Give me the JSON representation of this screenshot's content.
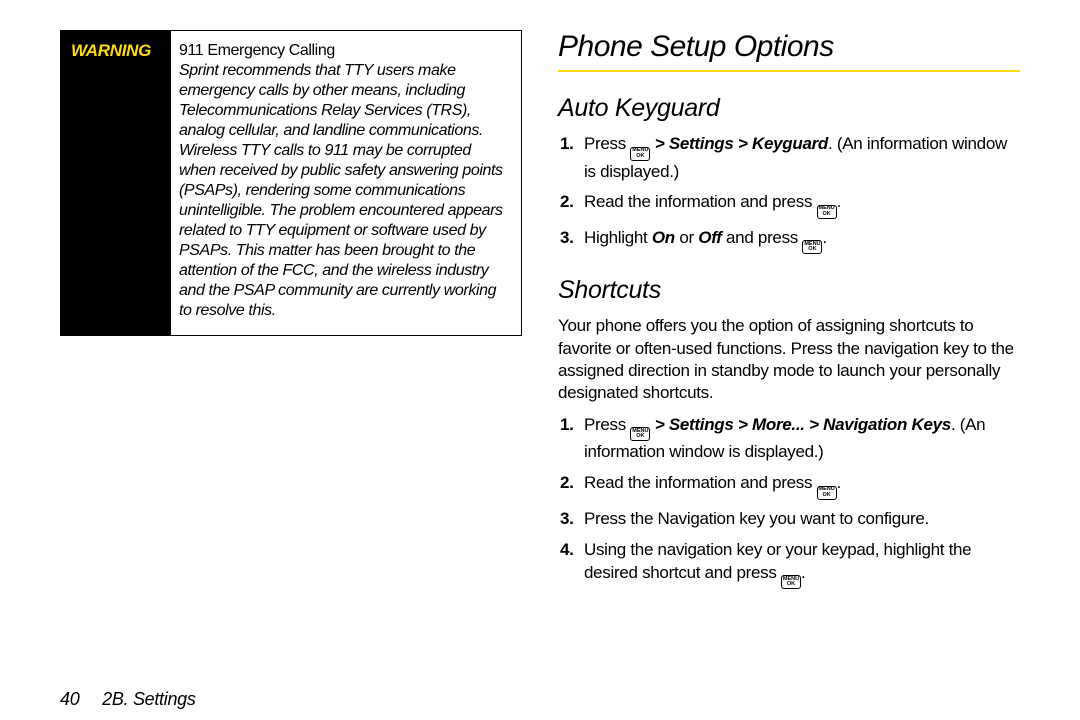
{
  "warning": {
    "label": "WARNING",
    "title": "911 Emergency Calling",
    "body": "Sprint recommends that TTY users make emergency calls by other means, including Telecommunications Relay Services (TRS), analog cellular, and landline communications. Wireless TTY calls to 911 may be corrupted when received by public safety answering points (PSAPs), rendering some communications unintelligible. The problem encountered appears related to TTY equipment or software used by PSAPs. This matter has been brought to the attention of the FCC, and the wireless industry and the PSAP community are currently working to resolve this."
  },
  "right": {
    "h1": "Phone Setup Options",
    "autokeyguard": {
      "h2": "Auto Keyguard",
      "steps": {
        "s1a": "Press ",
        "s1b": " > Settings > Keyguard",
        "s1c": ". (An information window is displayed.)",
        "s2a": "Read the information and press ",
        "s2b": ".",
        "s3a": "Highlight ",
        "s3b": "On",
        "s3c": " or ",
        "s3d": "Off",
        "s3e": " and press ",
        "s3f": "."
      }
    },
    "shortcuts": {
      "h2": "Shortcuts",
      "para": "Your phone offers you the option of assigning shortcuts to favorite or often-used functions. Press the navigation key to the assigned direction in standby mode to launch your personally designated shortcuts.",
      "steps": {
        "s1a": "Press ",
        "s1b": " > Settings > More... > Navigation Keys",
        "s1c": ". (An information window is displayed.)",
        "s2a": "Read the information and press ",
        "s2b": ".",
        "s3": "Press the Navigation key you want to configure.",
        "s4a": "Using the navigation key or your keypad, highlight the desired shortcut and press ",
        "s4b": "."
      }
    }
  },
  "footer": {
    "page": "40",
    "section": "2B. Settings"
  },
  "key": {
    "l1": "MENU",
    "l2": "OK"
  }
}
